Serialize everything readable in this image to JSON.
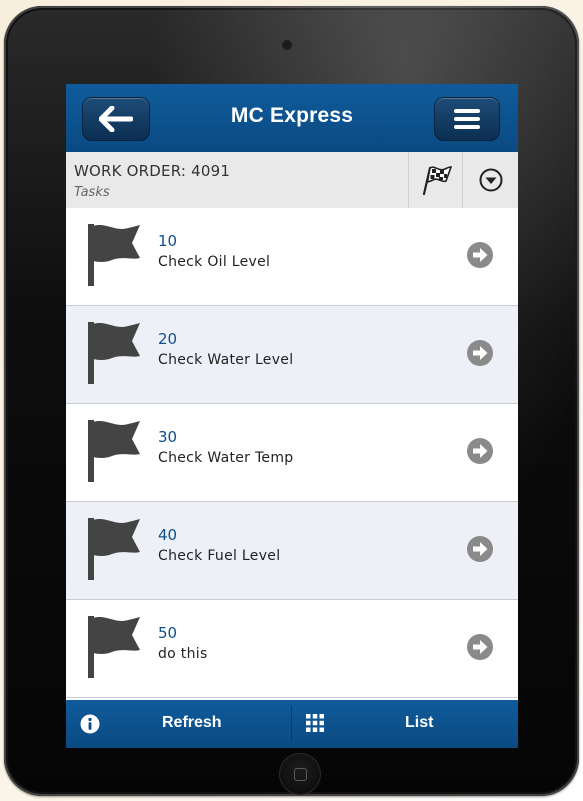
{
  "header": {
    "title": "MC Express",
    "back_icon": "back-arrow-icon",
    "menu_icon": "hamburger-menu-icon"
  },
  "work_order": {
    "title": "WORK ORDER: 4091",
    "subtitle": "Tasks",
    "flag_icon": "checkered-flag-icon",
    "dropdown_icon": "chevron-down-circle-icon"
  },
  "tasks": [
    {
      "number": "10",
      "label": "Check Oil Level"
    },
    {
      "number": "20",
      "label": "Check Water Level"
    },
    {
      "number": "30",
      "label": "Check Water Temp"
    },
    {
      "number": "40",
      "label": "Check Fuel Level"
    },
    {
      "number": "50",
      "label": "do this"
    }
  ],
  "footer": {
    "refresh_label": "Refresh",
    "list_label": "List",
    "info_icon": "info-icon",
    "grid_icon": "grid-icon"
  },
  "colors": {
    "header_blue": "#0a4a82",
    "task_number_blue": "#0d4f8b",
    "row_alt_bg": "#eef0f8",
    "flag_gray": "#444444",
    "arrow_gray": "#8a8a8a"
  }
}
